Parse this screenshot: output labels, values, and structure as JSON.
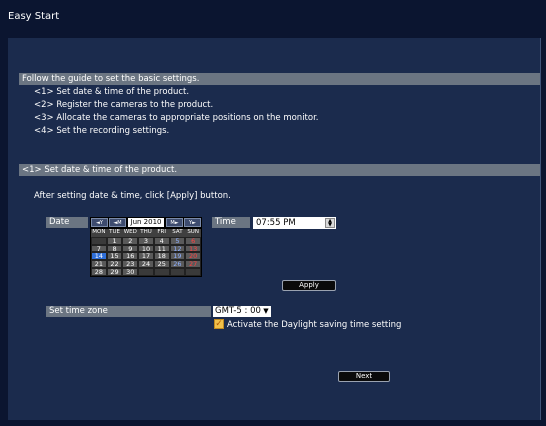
{
  "window": {
    "title": "Easy Start"
  },
  "intro": {
    "header": "Follow the guide to set the basic settings.",
    "steps": [
      "<1> Set date & time of the product.",
      "<2> Register the cameras to the product.",
      "<3> Allocate the cameras to appropriate positions on the monitor.",
      "<4> Set the recording settings."
    ]
  },
  "section1": {
    "header": "<1> Set date & time of the product.",
    "instruction": "After setting date & time, click [Apply] button."
  },
  "date": {
    "label": "Date",
    "prev_year": "◄Y",
    "prev_month": "◄M",
    "month_year": "Jun 2010",
    "next_month": "M►",
    "next_year": "Y►",
    "weekdays": [
      "MON",
      "TUE",
      "WED",
      "THU",
      "FRI",
      "SAT",
      "SUN"
    ],
    "weeks": [
      [
        "",
        "1",
        "2",
        "3",
        "4",
        "5",
        "6"
      ],
      [
        "7",
        "8",
        "9",
        "10",
        "11",
        "12",
        "13"
      ],
      [
        "14",
        "15",
        "16",
        "17",
        "18",
        "19",
        "20"
      ],
      [
        "21",
        "22",
        "23",
        "24",
        "25",
        "26",
        "27"
      ],
      [
        "28",
        "29",
        "30",
        "",
        "",
        "",
        ""
      ]
    ],
    "selected_day": "14"
  },
  "time": {
    "label": "Time",
    "value": "07:55 PM"
  },
  "apply_label": "Apply",
  "timezone": {
    "label": "Set time zone",
    "value": "GMT-5 : 00",
    "dst_label": "Activate the Daylight saving time setting",
    "dst_checked": true
  },
  "next_label": "Next"
}
